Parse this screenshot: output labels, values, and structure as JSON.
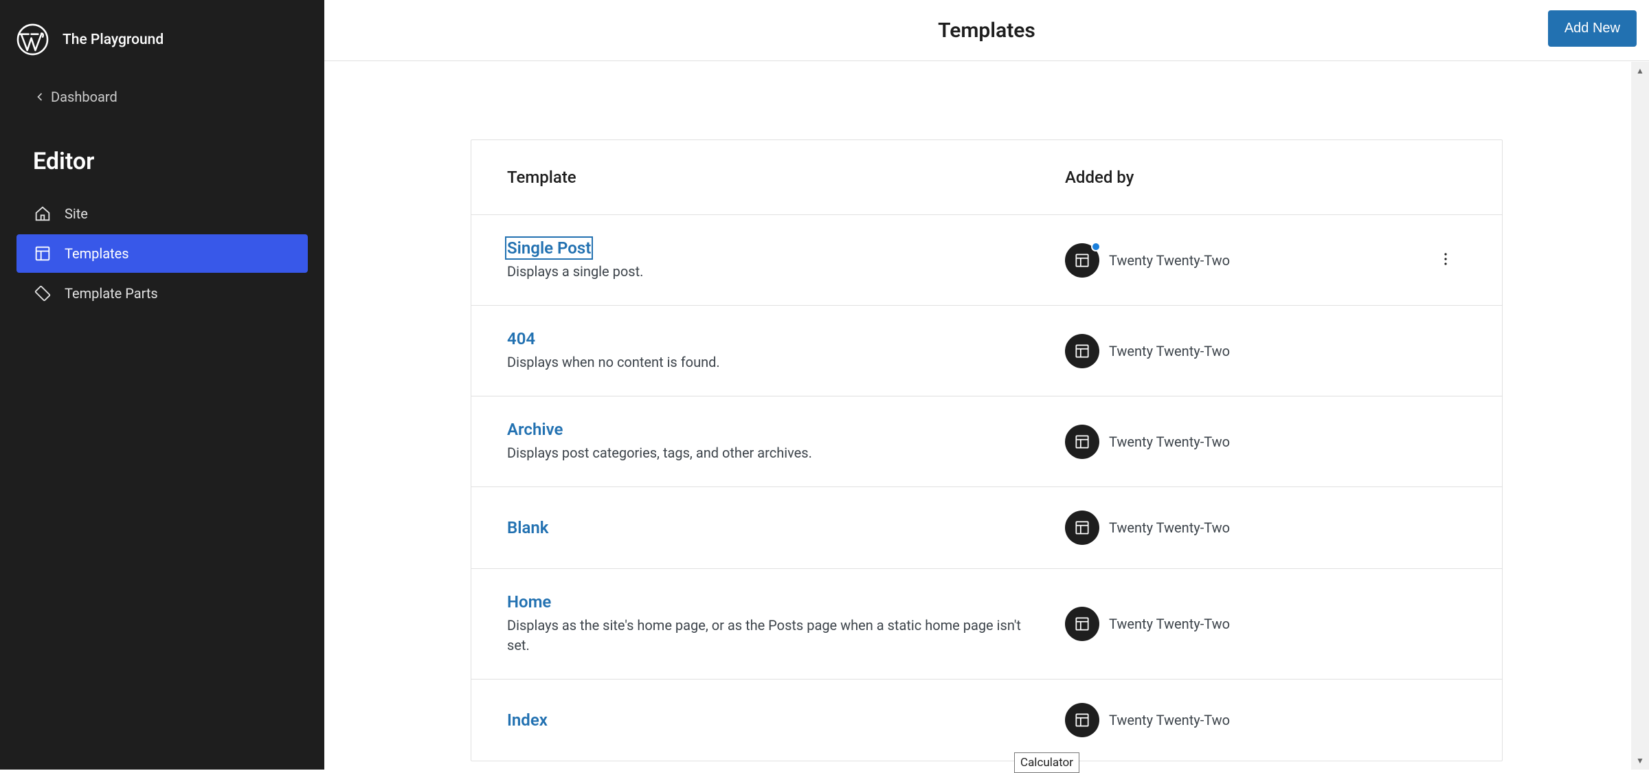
{
  "site_title": "The Playground",
  "back_link": "Dashboard",
  "sidebar_heading": "Editor",
  "nav": [
    {
      "label": "Site"
    },
    {
      "label": "Templates"
    },
    {
      "label": "Template Parts"
    }
  ],
  "page_title": "Templates",
  "add_new": "Add New",
  "table": {
    "col_template": "Template",
    "col_addedby": "Added by"
  },
  "rows": [
    {
      "name": "Single Post",
      "desc": "Displays a single post.",
      "added_by": "Twenty Twenty-Two",
      "focused": true,
      "has_dot": true,
      "has_actions": true
    },
    {
      "name": "404",
      "desc": "Displays when no content is found.",
      "added_by": "Twenty Twenty-Two"
    },
    {
      "name": "Archive",
      "desc": "Displays post categories, tags, and other archives.",
      "added_by": "Twenty Twenty-Two"
    },
    {
      "name": "Blank",
      "desc": "",
      "added_by": "Twenty Twenty-Two"
    },
    {
      "name": "Home",
      "desc": "Displays as the site's home page, or as the Posts page when a static home page isn't set.",
      "added_by": "Twenty Twenty-Two"
    },
    {
      "name": "Index",
      "desc": "",
      "added_by": "Twenty Twenty-Two"
    }
  ],
  "stray_label": "Calculator"
}
